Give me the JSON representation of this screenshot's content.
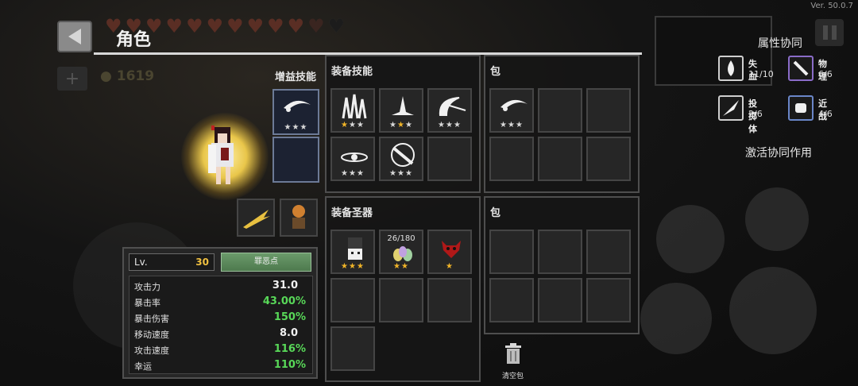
{
  "version": "Ver. 50.0.7",
  "header": {
    "title": "角色",
    "coins": "1619"
  },
  "hearts": {
    "full": 10,
    "half": 1,
    "empty": 1
  },
  "panels": {
    "boost_skill": "增益技能",
    "equip_skill": "装备技能",
    "bag": "包",
    "equip_relic": "装备圣器",
    "bag2": "包",
    "clear_bag": "清空包"
  },
  "boost_slots": [
    {
      "icon": "slash-swirl-icon",
      "stars": "★★★",
      "star_color": "gray"
    },
    {
      "icon": "",
      "stars": ""
    }
  ],
  "skill_slots": [
    {
      "icon": "spikes-icon",
      "stars": "★★★",
      "gold": 1
    },
    {
      "icon": "spike-burst-icon",
      "stars": "★★★",
      "gold": 2
    },
    {
      "icon": "crescent-icon",
      "stars": "★★★",
      "gold": 0
    },
    {
      "icon": "orbit-icon",
      "stars": "★★★",
      "gold": 0
    },
    {
      "icon": "moon-slash-icon",
      "stars": "★★★",
      "gold": 0
    },
    {
      "icon": "",
      "stars": ""
    }
  ],
  "bag_slots": [
    {
      "icon": "slash-swirl-icon",
      "stars": "★★★"
    }
  ],
  "relic_slots": [
    {
      "icon": "ghost-relic-icon",
      "stars": "★★★",
      "counter": ""
    },
    {
      "icon": "eggs-relic-icon",
      "stars": "★★",
      "counter": "26/180"
    },
    {
      "icon": "demon-relic-icon",
      "stars": "★",
      "counter": ""
    }
  ],
  "stats": {
    "level_label": "Lv.",
    "level": "30",
    "sin_button": "罪恶点",
    "rows": [
      {
        "name": "攻击力",
        "value": "31.0",
        "color": "white"
      },
      {
        "name": "暴击率",
        "value": "43.00%",
        "color": "green"
      },
      {
        "name": "暴击伤害",
        "value": "150%",
        "color": "green"
      },
      {
        "name": "移动速度",
        "value": "8.0",
        "color": "white"
      },
      {
        "name": "攻击速度",
        "value": "116%",
        "color": "green"
      },
      {
        "name": "幸运",
        "value": "110%",
        "color": "green"
      }
    ]
  },
  "synergy": {
    "title": "属性协同",
    "items": [
      {
        "name": "失血",
        "count": "11/10",
        "icon": "blood-drop-icon"
      },
      {
        "name": "物理",
        "count": "6/6",
        "icon": "sword-icon"
      },
      {
        "name": "投掷体",
        "count": "2/6",
        "icon": "throw-icon"
      },
      {
        "name": "近战",
        "count": "4/6",
        "icon": "fist-icon"
      }
    ],
    "activate_label": "激活协同作用"
  }
}
